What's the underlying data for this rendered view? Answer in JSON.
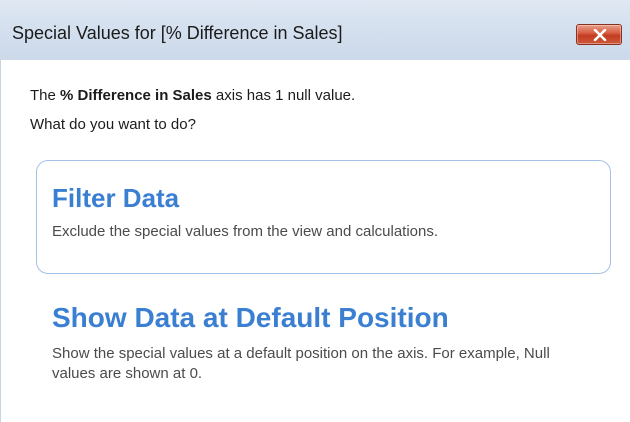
{
  "window": {
    "title": "Special Values for [% Difference in Sales]",
    "close_icon": "close-icon"
  },
  "message": {
    "line1_prefix": "The ",
    "line1_bold": "% Difference in Sales",
    "line1_suffix": " axis has 1 null value.",
    "line2": "What do you want to do?"
  },
  "options": [
    {
      "title": "Filter Data",
      "description": "Exclude the special values from the view and calculations."
    },
    {
      "title": "Show Data at Default Position",
      "description": "Show the special values at a default position on the axis. For example, Null values are shown at 0."
    }
  ],
  "colors": {
    "accent": "#3a7fd1",
    "close_button": "#c94a2c",
    "option_border": "#a3c1e6"
  }
}
